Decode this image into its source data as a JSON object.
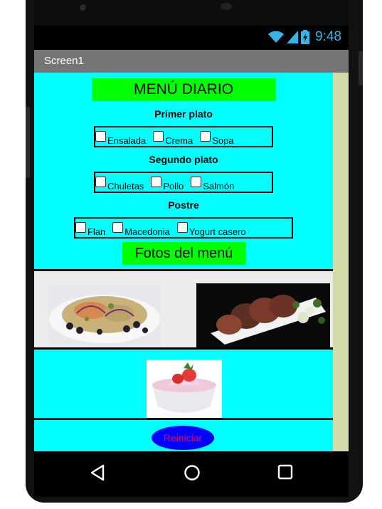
{
  "status_bar": {
    "time": "9:48"
  },
  "app": {
    "title": "Screen1"
  },
  "menu": {
    "title": "MENÚ DIARIO",
    "sections": [
      {
        "label": "Primer plato",
        "options": [
          "Ensalada",
          "Crema",
          "Sopa"
        ]
      },
      {
        "label": "Segundo plato",
        "options": [
          "Chuletas",
          "Pollo",
          "Salmón"
        ]
      },
      {
        "label": "Postre",
        "options": [
          "Flan",
          "Macedonia",
          "Yogurt casero"
        ]
      }
    ],
    "photos_label": "Fotos del menú",
    "reset_label": "Reiniciar"
  },
  "colors": {
    "background": "#00ffff",
    "highlight": "#00ff00",
    "button": "#0000ff",
    "button_text": "#ff0033"
  },
  "icons": [
    "wifi-icon",
    "signal-icon",
    "battery-icon",
    "back-icon",
    "home-icon",
    "recents-icon"
  ]
}
